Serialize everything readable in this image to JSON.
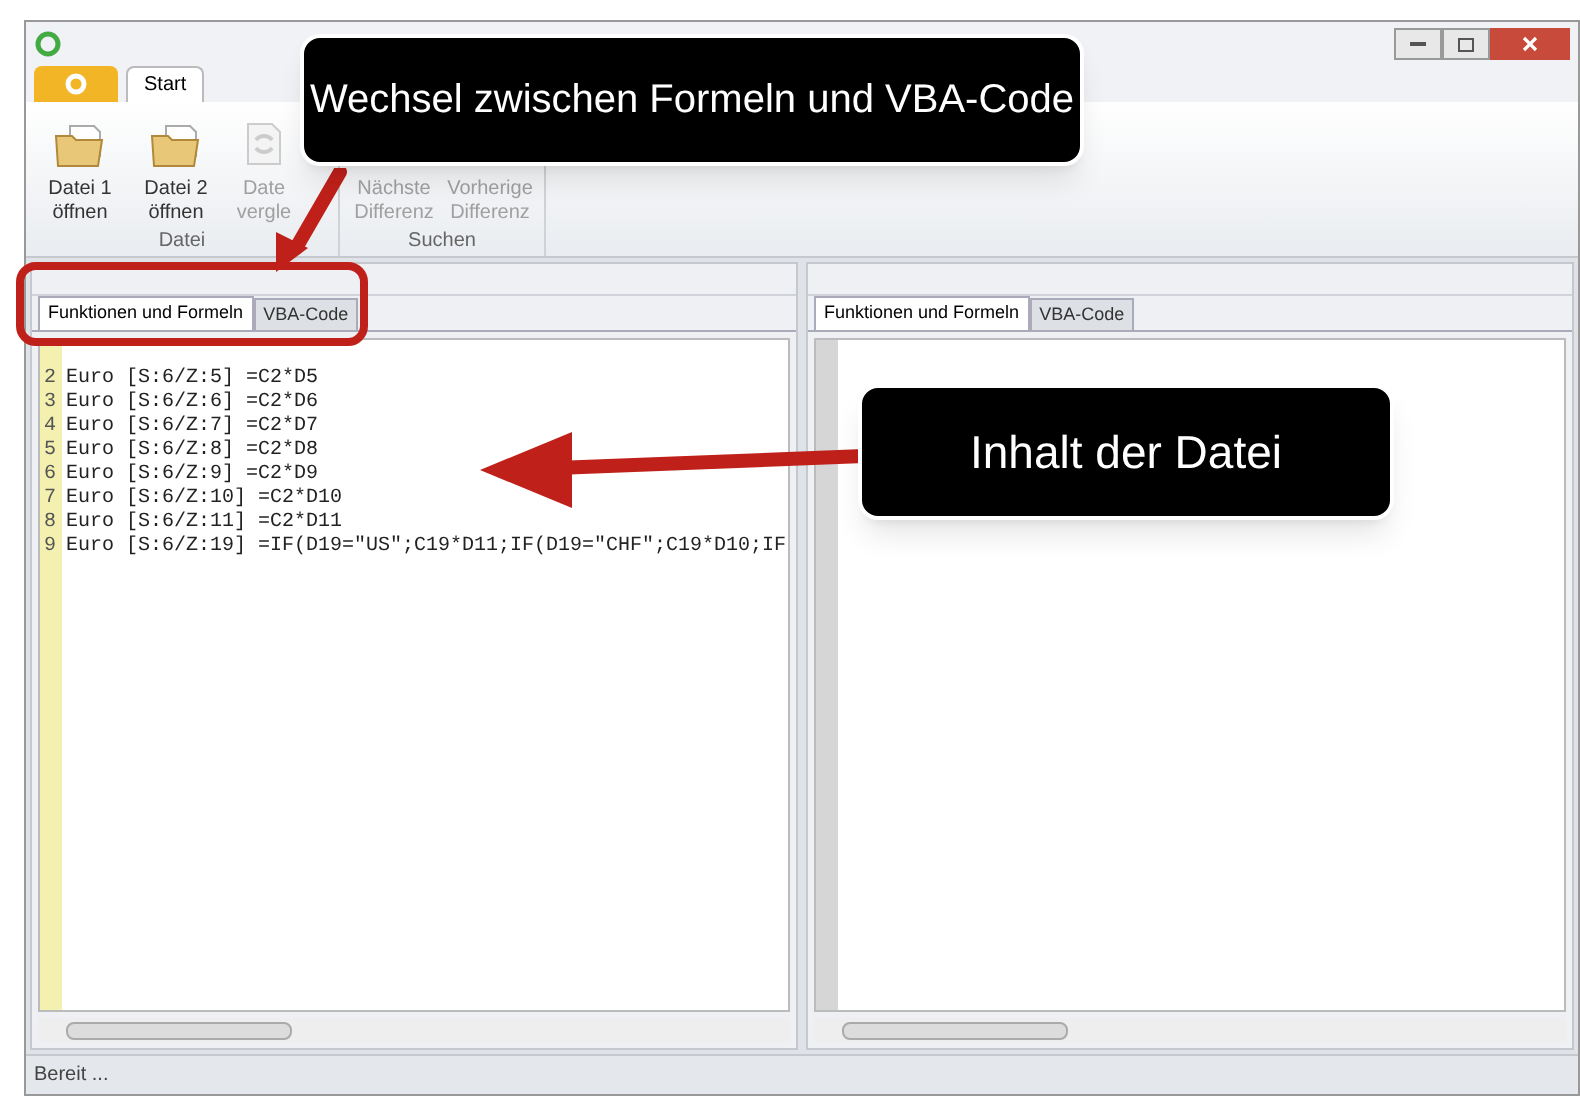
{
  "ribbon": {
    "tabs": [
      {
        "label": "Start",
        "selected": true
      }
    ],
    "groups": [
      {
        "label": "Datei",
        "buttons": [
          {
            "label": "Datei 1 öffnen",
            "disabled": false,
            "kind": "folder"
          },
          {
            "label": "Datei 2 öffnen",
            "disabled": false,
            "kind": "folder"
          },
          {
            "label": "Date vergle",
            "disabled": true,
            "kind": "compare"
          }
        ]
      },
      {
        "label": "Suchen",
        "buttons": [
          {
            "label": "Nächste Differenz",
            "disabled": true,
            "kind": "text"
          },
          {
            "label": "Vorherige Differenz",
            "disabled": true,
            "kind": "text"
          }
        ]
      }
    ]
  },
  "panes": [
    {
      "tabs": [
        {
          "label": "Funktionen und Formeln",
          "selected": true
        },
        {
          "label": "VBA-Code",
          "selected": false
        }
      ],
      "lines": [
        {
          "number": "2",
          "text": "Euro [S:6/Z:5] =C2*D5"
        },
        {
          "number": "3",
          "text": "Euro [S:6/Z:6] =C2*D6"
        },
        {
          "number": "4",
          "text": "Euro [S:6/Z:7] =C2*D7"
        },
        {
          "number": "5",
          "text": "Euro [S:6/Z:8] =C2*D8"
        },
        {
          "number": "6",
          "text": "Euro [S:6/Z:9] =C2*D9"
        },
        {
          "number": "7",
          "text": "Euro [S:6/Z:10] =C2*D10"
        },
        {
          "number": "8",
          "text": "Euro [S:6/Z:11] =C2*D11"
        },
        {
          "number": "9",
          "text": "Euro [S:6/Z:19] =IF(D19=\"US\";C19*D11;IF(D19=\"CHF\";C19*D10;IF"
        }
      ]
    },
    {
      "tabs": [
        {
          "label": "Funktionen und Formeln",
          "selected": true
        },
        {
          "label": "VBA-Code",
          "selected": false
        }
      ]
    }
  ],
  "status_bar": "Bereit ...",
  "annotations": [
    {
      "text": "Wechsel zwischen Formeln und VBA-Code"
    },
    {
      "text": "Inhalt der Datei"
    }
  ]
}
